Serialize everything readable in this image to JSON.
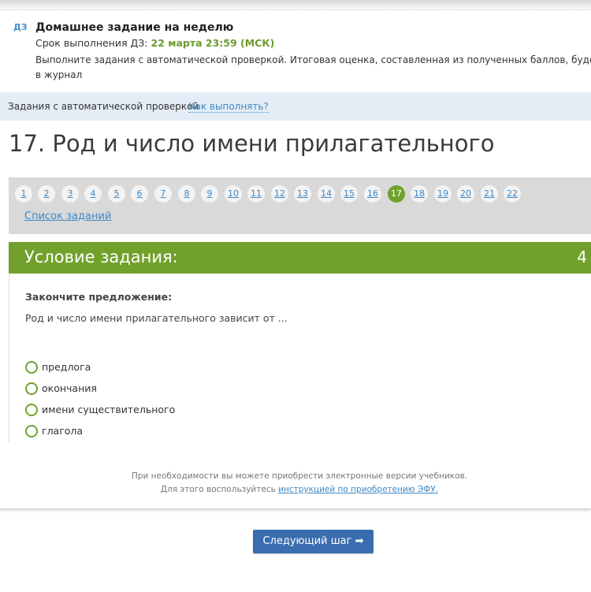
{
  "homework": {
    "icon_label": "ДЗ",
    "title": "Домашнее задание на неделю",
    "deadline_label": "Срок выполнения ДЗ:",
    "deadline_value": "22 марта 23:59 (МСК)",
    "description_line1": "Выполните задания с автоматической проверкой. Итоговая оценка, составленная из полученных баллов, будет выставлена",
    "description_line2": "в журнал"
  },
  "auto_check": {
    "label": "Задания с автоматической проверкой",
    "how_link": "Как выполнять?"
  },
  "task": {
    "title": "17. Род и число имени прилагательного"
  },
  "pager": {
    "items": [
      "1",
      "2",
      "3",
      "4",
      "5",
      "6",
      "7",
      "8",
      "9",
      "10",
      "11",
      "12",
      "13",
      "14",
      "15",
      "16",
      "17",
      "18",
      "19",
      "20",
      "21",
      "22"
    ],
    "current": "17",
    "task_list_link": "Список заданий"
  },
  "condition": {
    "title": "Условие задания:",
    "number": "4",
    "instruction": "Закончите предложение:",
    "question": "Род и число имени прилагательного зависит от ...",
    "options": [
      "предлога",
      "окончания",
      "имени существительного",
      "глагола"
    ]
  },
  "footer": {
    "line1": "При необходимости вы можете приобрести электронные версии учебников.",
    "line2_prefix": "Для этого воспользуйтесь",
    "line2_link": "инструкцией по приобретению ЭФУ."
  },
  "next_button": {
    "label": "Следующий шаг ➡"
  },
  "colors": {
    "accent_green": "#72a12b",
    "link_blue": "#3f88c5",
    "button_blue": "#3a6daf",
    "info_bar": "#e4edf6"
  }
}
